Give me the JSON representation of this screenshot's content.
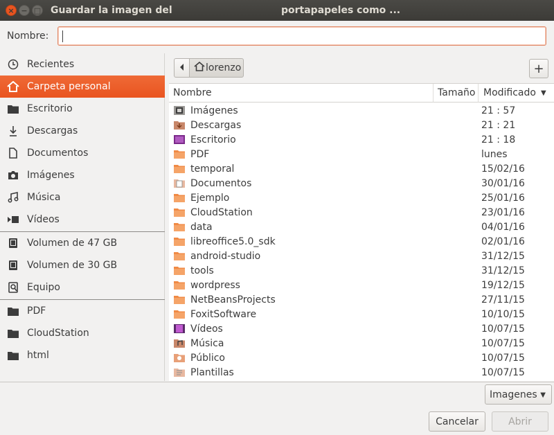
{
  "window": {
    "title_part1": "Guardar la imagen del",
    "title_part2": "portapapeles como ..."
  },
  "name_row": {
    "label": "Nombre:",
    "value": ""
  },
  "sidebar": {
    "items": [
      {
        "label": "Recientes",
        "icon": "clock-icon"
      },
      {
        "label": "Carpeta personal",
        "icon": "home-icon",
        "active": true
      },
      {
        "label": "Escritorio",
        "icon": "folder-icon"
      },
      {
        "label": "Descargas",
        "icon": "download-icon"
      },
      {
        "label": "Documentos",
        "icon": "document-icon"
      },
      {
        "label": "Imágenes",
        "icon": "camera-icon"
      },
      {
        "label": "Música",
        "icon": "music-icon"
      },
      {
        "label": "Vídeos",
        "icon": "video-icon"
      }
    ],
    "devices": [
      {
        "label": "Volumen de 47 GB",
        "icon": "drive-icon"
      },
      {
        "label": "Volumen de 30 GB",
        "icon": "drive-icon"
      },
      {
        "label": "Equipo",
        "icon": "computer-icon"
      }
    ],
    "bookmarks": [
      {
        "label": "PDF",
        "icon": "folder-icon"
      },
      {
        "label": "CloudStation",
        "icon": "folder-icon"
      },
      {
        "label": "html",
        "icon": "folder-icon"
      }
    ]
  },
  "pathbar": {
    "current": "lorenzo",
    "add_folder": "+"
  },
  "filelist": {
    "columns": {
      "name": "Nombre",
      "size": "Tamaño",
      "modified": "Modificado"
    },
    "rows": [
      {
        "name": "Imágenes",
        "date": "21 : 57",
        "icon": "pictures-folder-icon"
      },
      {
        "name": "Descargas",
        "date": "21 : 21",
        "icon": "downloads-folder-icon"
      },
      {
        "name": "Escritorio",
        "date": "21 : 18",
        "icon": "desktop-folder-icon"
      },
      {
        "name": "PDF",
        "date": "lunes",
        "icon": "folder-icon"
      },
      {
        "name": "temporal",
        "date": "15/02/16",
        "icon": "folder-icon"
      },
      {
        "name": "Documentos",
        "date": "30/01/16",
        "icon": "documents-folder-icon"
      },
      {
        "name": "Ejemplo",
        "date": "25/01/16",
        "icon": "folder-icon"
      },
      {
        "name": "CloudStation",
        "date": "23/01/16",
        "icon": "folder-icon"
      },
      {
        "name": "data",
        "date": "04/01/16",
        "icon": "folder-icon"
      },
      {
        "name": "libreoffice5.0_sdk",
        "date": "02/01/16",
        "icon": "folder-icon"
      },
      {
        "name": "android-studio",
        "date": "31/12/15",
        "icon": "folder-icon"
      },
      {
        "name": "tools",
        "date": "31/12/15",
        "icon": "folder-icon"
      },
      {
        "name": "wordpress",
        "date": "19/12/15",
        "icon": "folder-icon"
      },
      {
        "name": "NetBeansProjects",
        "date": "27/11/15",
        "icon": "folder-icon"
      },
      {
        "name": "FoxitSoftware",
        "date": "10/10/15",
        "icon": "folder-icon"
      },
      {
        "name": "Vídeos",
        "date": "10/07/15",
        "icon": "videos-folder-icon"
      },
      {
        "name": "Música",
        "date": "10/07/15",
        "icon": "music-folder-icon"
      },
      {
        "name": "Público",
        "date": "10/07/15",
        "icon": "public-folder-icon"
      },
      {
        "name": "Plantillas",
        "date": "10/07/15",
        "icon": "templates-folder-icon"
      }
    ]
  },
  "filter": {
    "selected": "Imagenes"
  },
  "buttons": {
    "cancel": "Cancelar",
    "open": "Abrir"
  },
  "colors": {
    "accent": "#e95420",
    "folder": "#f08a45",
    "titlebar": "#3c3b37"
  }
}
